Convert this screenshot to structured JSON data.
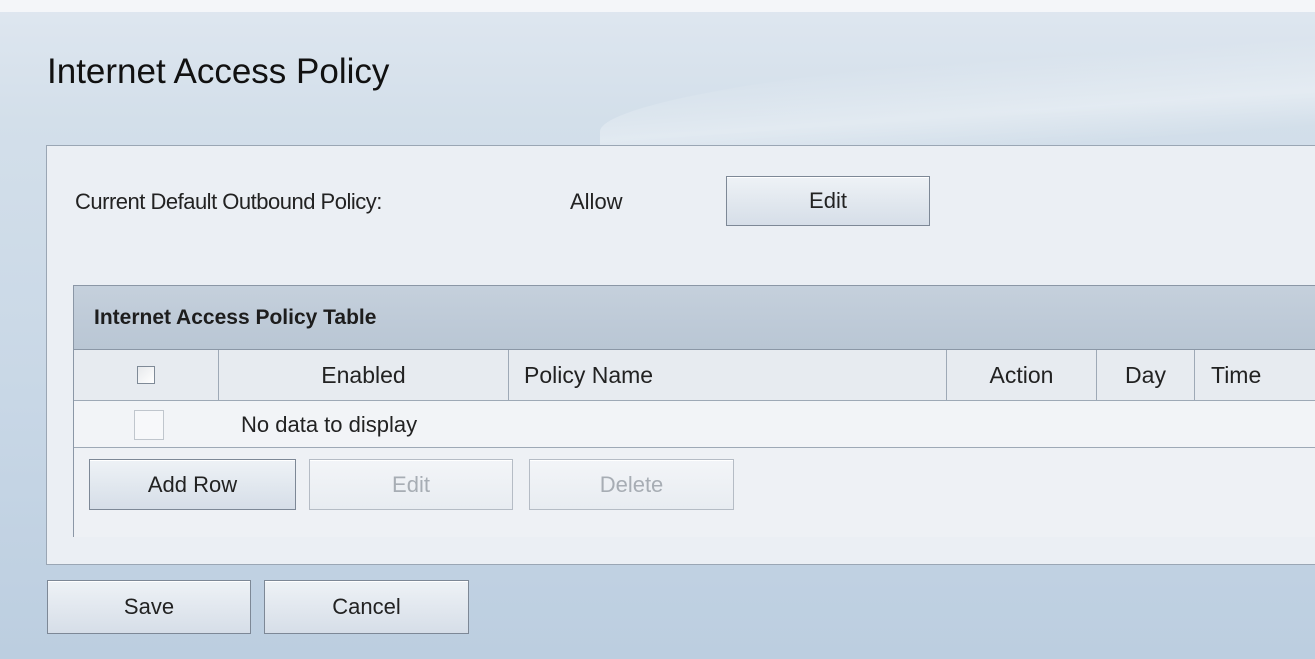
{
  "page": {
    "title": "Internet Access Policy"
  },
  "default_policy": {
    "label": "Current Default Outbound Policy:",
    "value": "Allow",
    "edit_label": "Edit"
  },
  "table": {
    "caption": "Internet Access Policy Table",
    "columns": [
      "Enabled",
      "Policy Name",
      "Action",
      "Day",
      "Time"
    ],
    "empty_message": "No data to display",
    "buttons": {
      "add_row": "Add Row",
      "edit": "Edit",
      "delete": "Delete"
    }
  },
  "footer": {
    "save_label": "Save",
    "cancel_label": "Cancel"
  }
}
